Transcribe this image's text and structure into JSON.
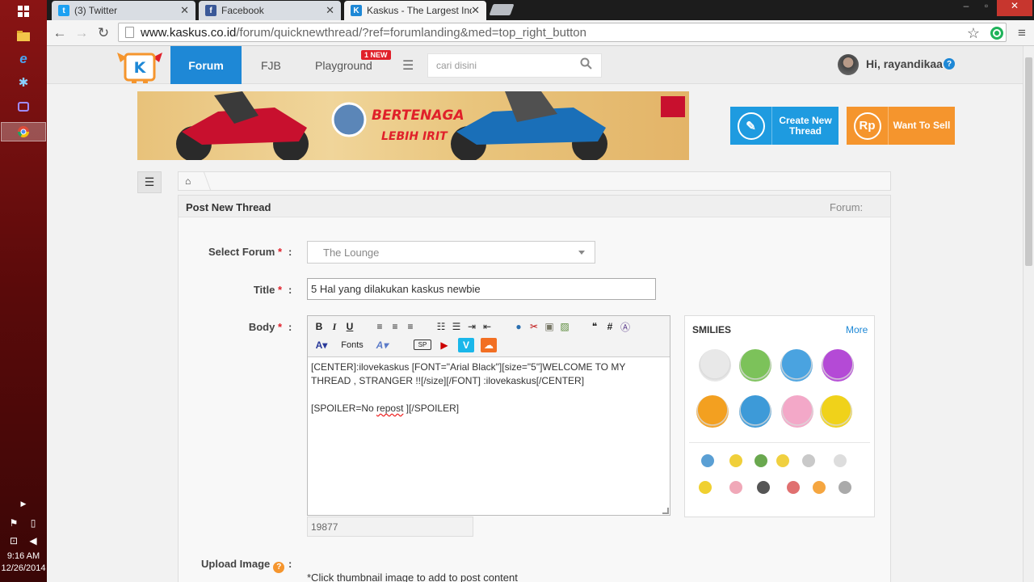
{
  "taskbar": {
    "time": "9:16 AM",
    "date": "12/26/2014"
  },
  "browser": {
    "tabs": [
      {
        "label": "(3) Twitter",
        "color": "#1da1f2"
      },
      {
        "label": "Facebook",
        "color": "#3b5998"
      },
      {
        "label": "Kaskus - The Largest Indo",
        "color": "#1e88d6"
      }
    ],
    "url_host": "www.kaskus.co.id",
    "url_path": "/forum/quicknewthread/?ref=forumlanding&med=top_right_button"
  },
  "site": {
    "nav": {
      "forum": "Forum",
      "fjb": "FJB",
      "playground": "Playground",
      "new_badge": "1 NEW"
    },
    "search_placeholder": "cari disini",
    "user_greeting": "Hi, rayandikaa",
    "banner": {
      "line1": "BERTENAGA",
      "line2": "LEBIH IRIT"
    },
    "create_thread": "Create New Thread",
    "want_to_sell": "Want To Sell",
    "sell_icon": "Rp"
  },
  "form": {
    "title": "Post New Thread",
    "forum_label": "Forum:",
    "select_forum_label": "Select Forum",
    "select_forum_value": "The Lounge",
    "title_label": "Title",
    "title_value": "5 Hal yang dilakukan kaskus newbie",
    "body_label": "Body",
    "body_line1": "[CENTER]:ilovekaskus [FONT=\"Arial Black\"][size=\"5\"]WELCOME TO MY THREAD , STRANGER !![/size][/FONT] :ilovekaskus[/CENTER]",
    "body_line2_pre": "[SPOILER=No ",
    "body_line2_err": "repost",
    "body_line2_post": " ][/SPOILER]",
    "fonts_label": "Fonts",
    "char_count": "19877",
    "upload_label": "Upload Image",
    "upload_note": "*Click thumbnail image to add to post content",
    "required_mark": "*",
    "colon": ":"
  },
  "smilies": {
    "title": "SMILIES",
    "more": "More",
    "big_colors": [
      "#e8e8e8",
      "#7cc25a",
      "#4aa3e0",
      "#b44ad6",
      "#f3a020",
      "#3d9ad8",
      "#f3a8c8",
      "#f0d21a"
    ],
    "small_colors": [
      "#5a9fd4",
      "#f0cf3a",
      "#6aa84f",
      "#f0d040",
      "#c9c9c9",
      "#dddddd",
      "#f0d030",
      "#f0a8b8",
      "#555555",
      "#e07070",
      "#f5a640",
      "#aaaaaa"
    ]
  }
}
